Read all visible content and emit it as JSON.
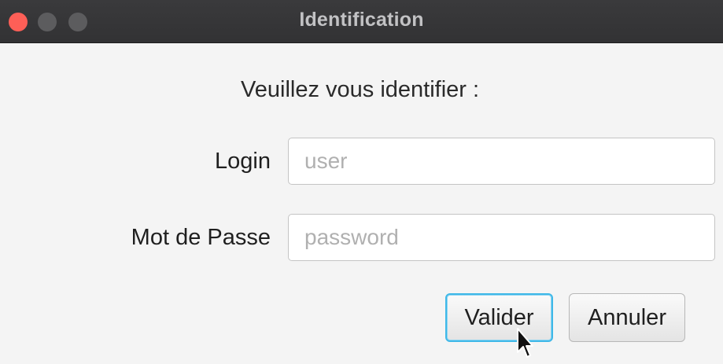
{
  "window": {
    "title": "Identification"
  },
  "form": {
    "prompt": "Veuillez vous identifier :",
    "login_label": "Login",
    "login_placeholder": "user",
    "password_label": "Mot de Passe",
    "password_placeholder": "password"
  },
  "buttons": {
    "validate_label": "Valider",
    "cancel_label": "Annuler"
  },
  "colors": {
    "titlebar": "#3a3a3c",
    "close": "#fe5f57",
    "focus_ring": "#3fb8e8",
    "background": "#f4f4f4"
  },
  "icons": {
    "close": "close-window-icon",
    "minimize": "minimize-window-icon",
    "maximize": "maximize-window-icon",
    "cursor": "mouse-pointer-icon"
  }
}
